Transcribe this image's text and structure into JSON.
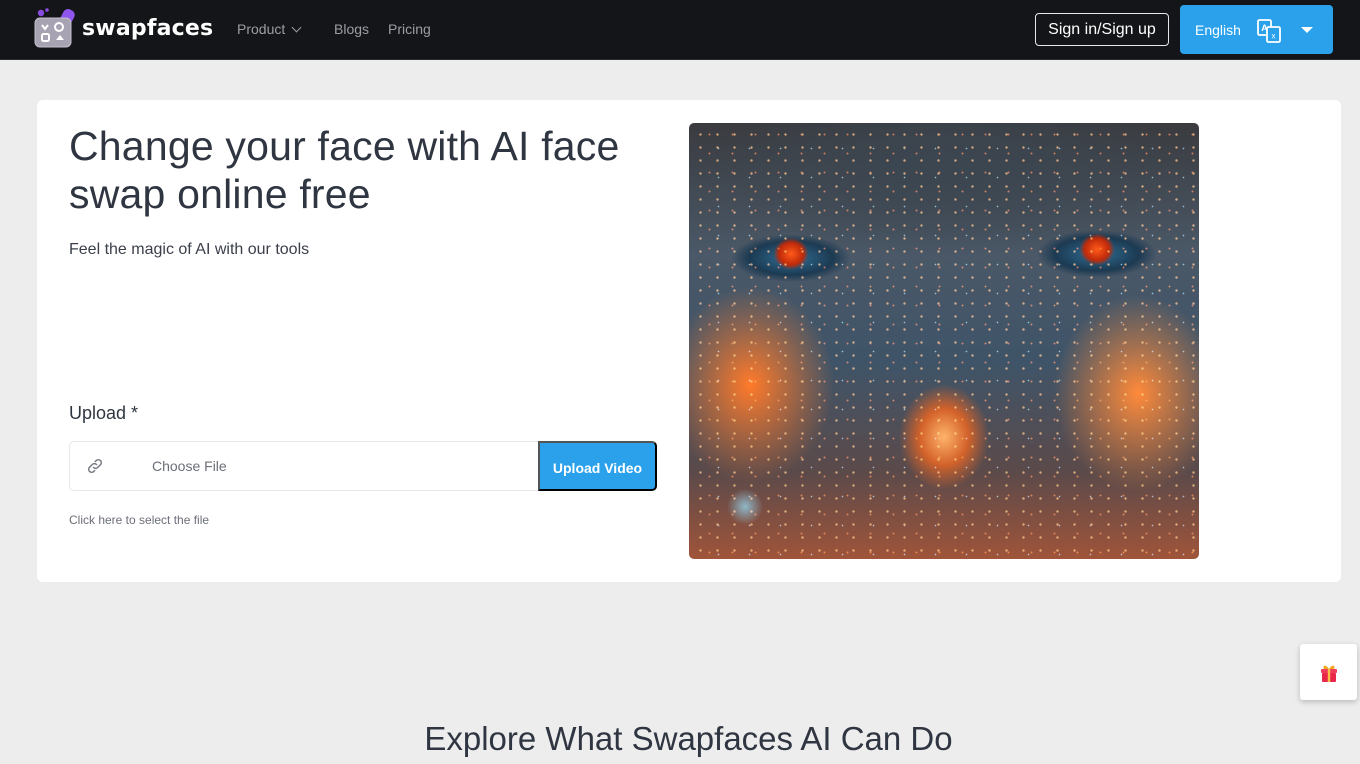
{
  "header": {
    "brand": "swapfaces",
    "nav": [
      {
        "label": "Product",
        "has_dropdown": true
      },
      {
        "label": "Blogs"
      },
      {
        "label": "Pricing"
      }
    ],
    "signin_label": "Sign in/Sign up",
    "language": {
      "label": "English",
      "icon": "translate-icon"
    }
  },
  "hero": {
    "title": "Change your face with AI face swap online free",
    "subtitle": "Feel the magic of AI with our tools",
    "upload": {
      "label": "Upload *",
      "link_icon": "link-icon",
      "choose_file": "Choose File",
      "button_label": "Upload Video",
      "hint": "Click here to select the file"
    },
    "image_alt": "Close-up of a face covered in glowing orange and blue particles"
  },
  "floating": {
    "gift_icon": "gift-icon"
  },
  "section": {
    "title": "Explore What Swapfaces AI Can Do"
  },
  "colors": {
    "navbar": "#141518",
    "accent": "#2ba1ec",
    "page_bg": "#ededed",
    "text": "#2f3541"
  }
}
